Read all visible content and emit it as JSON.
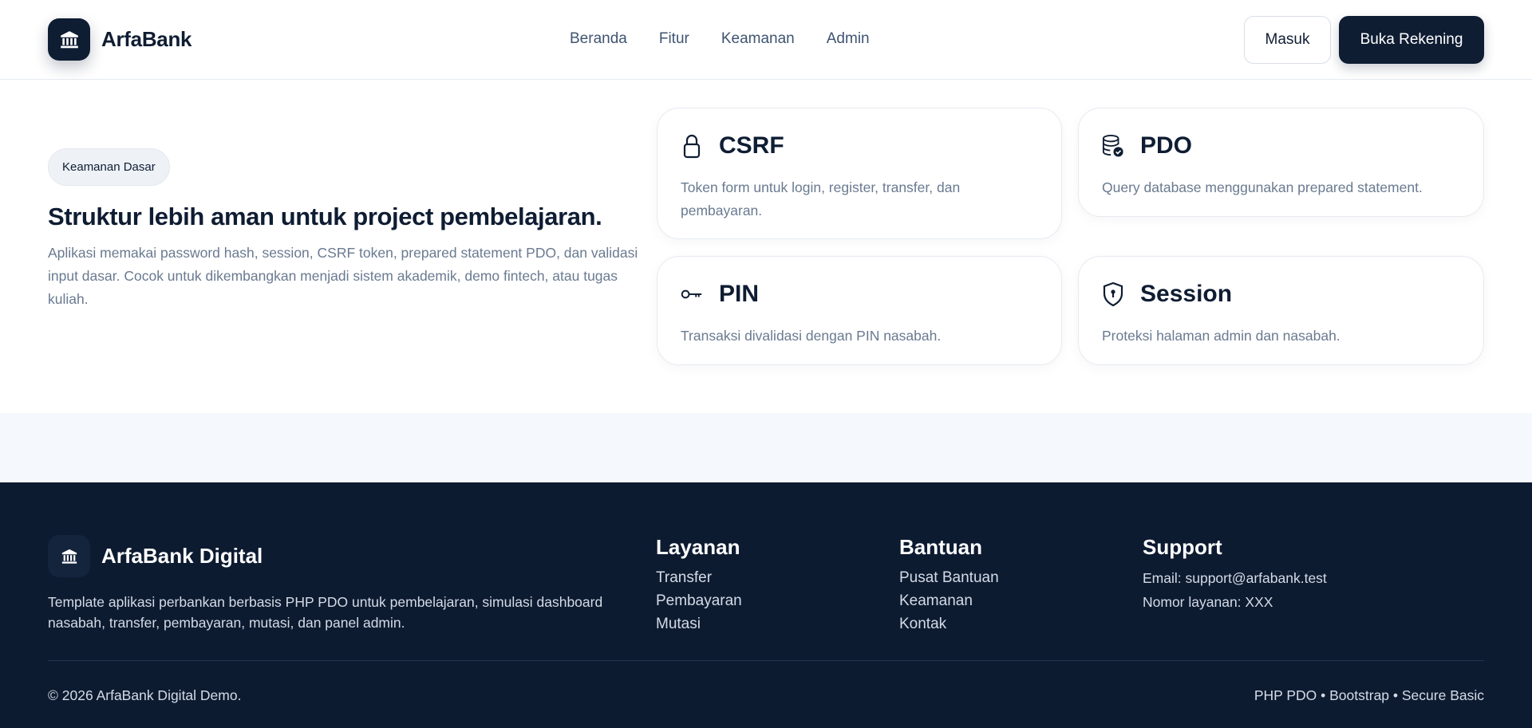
{
  "brand": {
    "name": "ArfaBank",
    "logo_icon": "bank-icon"
  },
  "nav": [
    {
      "label": "Beranda"
    },
    {
      "label": "Fitur"
    },
    {
      "label": "Keamanan"
    },
    {
      "label": "Admin"
    }
  ],
  "actions": {
    "login_label": "Masuk",
    "register_label": "Buka Rekening"
  },
  "hero": {
    "badge": "Keamanan Dasar",
    "title": "Struktur lebih aman untuk project pembelajaran.",
    "description": "Aplikasi memakai password hash, session, CSRF token, prepared statement PDO, dan validasi input dasar. Cocok untuk dikembangkan menjadi sistem akademik, demo fintech, atau tugas kuliah."
  },
  "features": [
    {
      "icon": "lock-icon",
      "title": "CSRF",
      "description": "Token form untuk login, register, transfer, dan pembayaran."
    },
    {
      "icon": "database-check-icon",
      "title": "PDO",
      "description": "Query database menggunakan prepared statement."
    },
    {
      "icon": "key-icon",
      "title": "PIN",
      "description": "Transaksi divalidasi dengan PIN nasabah."
    },
    {
      "icon": "shield-lock-icon",
      "title": "Session",
      "description": "Proteksi halaman admin dan nasabah."
    }
  ],
  "footer": {
    "brand_name": "ArfaBank Digital",
    "description": "Template aplikasi perbankan berbasis PHP PDO untuk pembelajaran, simulasi dashboard nasabah, transfer, pembayaran, mutasi, dan panel admin.",
    "layanan": {
      "heading": "Layanan",
      "links": [
        "Transfer",
        "Pembayaran",
        "Mutasi"
      ]
    },
    "bantuan": {
      "heading": "Bantuan",
      "links": [
        "Pusat Bantuan",
        "Keamanan",
        "Kontak"
      ]
    },
    "support": {
      "heading": "Support",
      "email": "Email: support@arfabank.test",
      "phone": "Nomor layanan: XXX"
    },
    "copyright": "© 2026 ArfaBank Digital Demo.",
    "tech": "PHP PDO • Bootstrap • Secure Basic"
  },
  "colors": {
    "primary": "#0f1d33",
    "footer_bg": "#0d1b31",
    "muted_text": "#6a7a90",
    "band_bg": "#f5f8fc"
  }
}
